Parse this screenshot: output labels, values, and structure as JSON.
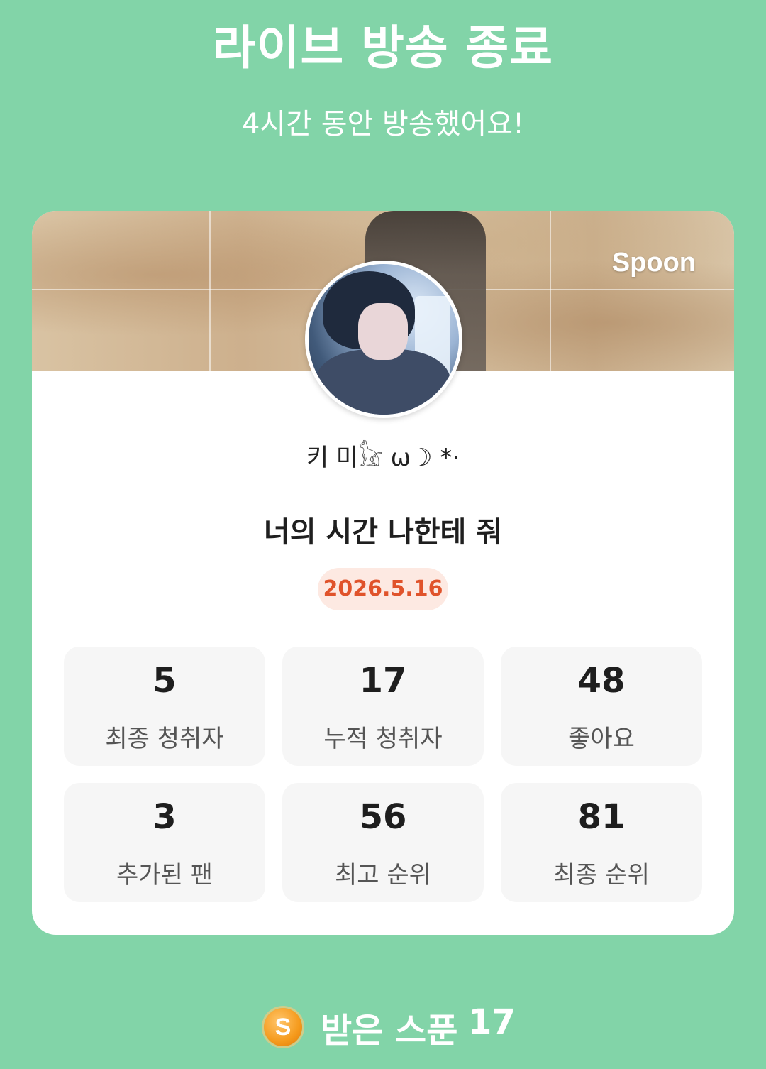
{
  "header": {
    "title": "라이브 방송 종료",
    "subtitle": "4시간 동안 방송했어요!"
  },
  "card": {
    "brand": "Spoon",
    "nickname": "키 미𓃠 ω☽ *·",
    "live_title": "너의 시간 나한테 줘",
    "date": "2026.5.16",
    "stats": [
      {
        "value": "5",
        "label": "최종 청취자"
      },
      {
        "value": "17",
        "label": "누적 청취자"
      },
      {
        "value": "48",
        "label": "좋아요"
      },
      {
        "value": "3",
        "label": "추가된 팬"
      },
      {
        "value": "56",
        "label": "최고 순위"
      },
      {
        "value": "81",
        "label": "최종 순위"
      }
    ]
  },
  "footer": {
    "coin_letter": "S",
    "spoons_label": "받은 스푼",
    "spoons_count": "17"
  },
  "colors": {
    "background": "#82d4a8",
    "date_text": "#e0532b",
    "date_bg": "#fde9e2",
    "coin": "#f59a1c"
  }
}
